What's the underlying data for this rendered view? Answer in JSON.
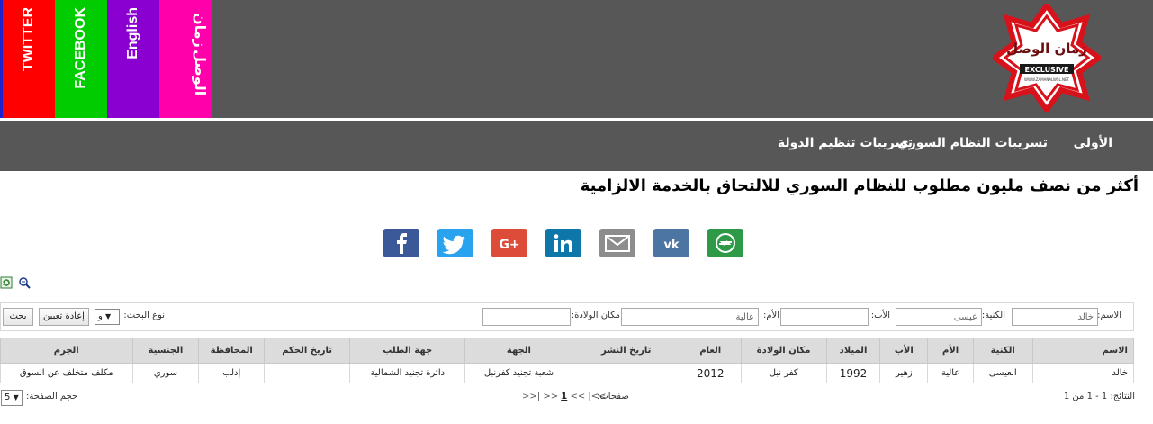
{
  "social_tabs": {
    "twitter": "TWITTER",
    "facebook": "FACEBOOK",
    "english": "English",
    "zaman_line1": "زمان",
    "zaman_line2": "الوصل"
  },
  "logo": {
    "name": "زمان الوصل",
    "ribbon": "EXCLUSIVE",
    "url": "WWW.ZAMANALWSL.NET"
  },
  "nav": {
    "home": "الأولى",
    "regime_leaks": "تسريبات النظام السوري",
    "isis_leaks": "تسريبات تنظيم الدولة"
  },
  "headline": "أكثر من نصف مليون مطلوب للنظام السوري للالتحاق بالخدمة الالزامية",
  "search": {
    "name_label": "الاسم:",
    "name_value": "خالد",
    "surname_label": "الكنية:",
    "surname_value": "عيسى",
    "father_label": "الأب:",
    "father_value": "",
    "mother_label": "الأم:",
    "mother_value": "عالية",
    "birthplace_label": "مكان الولادة:",
    "birthplace_value": "",
    "search_type_label": "نوع البحث:",
    "search_type_value": "و",
    "reset_label": "إعادة تعيين",
    "search_label": "بحث"
  },
  "table": {
    "headers": [
      "الاسم",
      "الكنية",
      "الأم",
      "الأب",
      "الميلاد",
      "مكان الولادة",
      "العام",
      "تاريخ النشر",
      "الجهة",
      "جهة الطلب",
      "تاريخ الحكم",
      "المحافظة",
      "الجنسية",
      "الجرم"
    ],
    "rows": [
      [
        "خالد",
        "العيسى",
        "عالية",
        "زهير",
        "1992",
        "كفر نبل",
        "2012",
        "",
        "شعبة تجنيد كفرنبل",
        "دائرة تجنيد الشمالية",
        "",
        "إدلب",
        "سوري",
        "مكلف متخلف عن السوق"
      ]
    ]
  },
  "footer": {
    "results": "النتائج: 1 - 1 من 1",
    "pages_label": "صفحات:",
    "pager_first": "|<<",
    "pager_prev": "<<",
    "pager_current": "1",
    "pager_next": ">>",
    "pager_last": ">>|",
    "page_size_label": "حجم الصفحة:",
    "page_size_value": "5"
  },
  "colors": {
    "header_bg": "#575757",
    "twitter": "#ff0000",
    "facebook": "#00cc00",
    "english": "#8a00d0",
    "zaman": "#ff00aa"
  }
}
